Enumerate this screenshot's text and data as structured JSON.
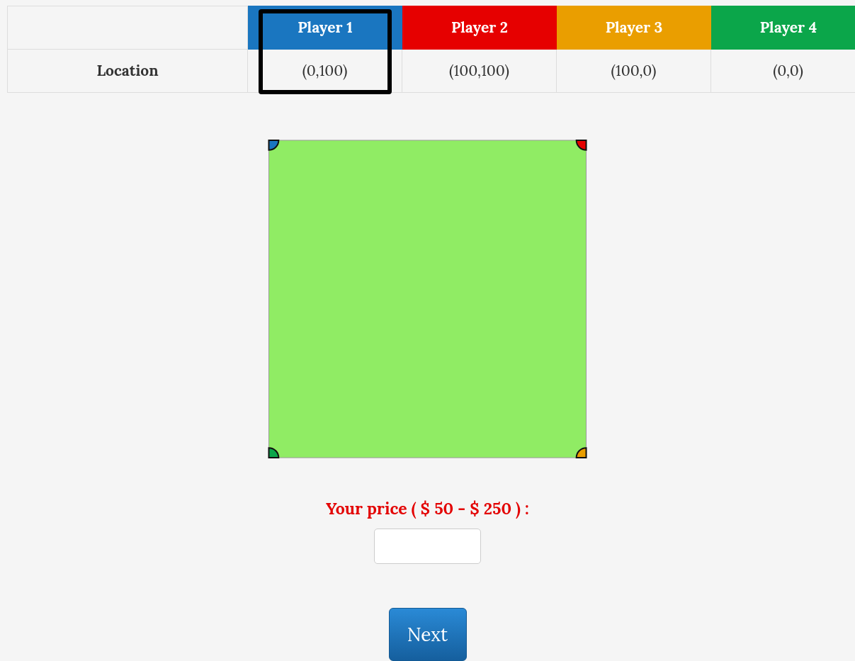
{
  "table": {
    "row_label": "Location",
    "players": [
      {
        "name": "Player 1",
        "location": "(0,100)",
        "color": "#1a76c0",
        "selected": true
      },
      {
        "name": "Player 2",
        "location": "(100,100)",
        "color": "#e60000",
        "selected": false
      },
      {
        "name": "Player 3",
        "location": "(100,0)",
        "color": "#ea9e00",
        "selected": false
      },
      {
        "name": "Player 4",
        "location": "(0,0)",
        "color": "#0ba64a",
        "selected": false
      }
    ]
  },
  "price_label": "Your price ( $ 50 - $ 250 ) :",
  "next_button": "Next"
}
